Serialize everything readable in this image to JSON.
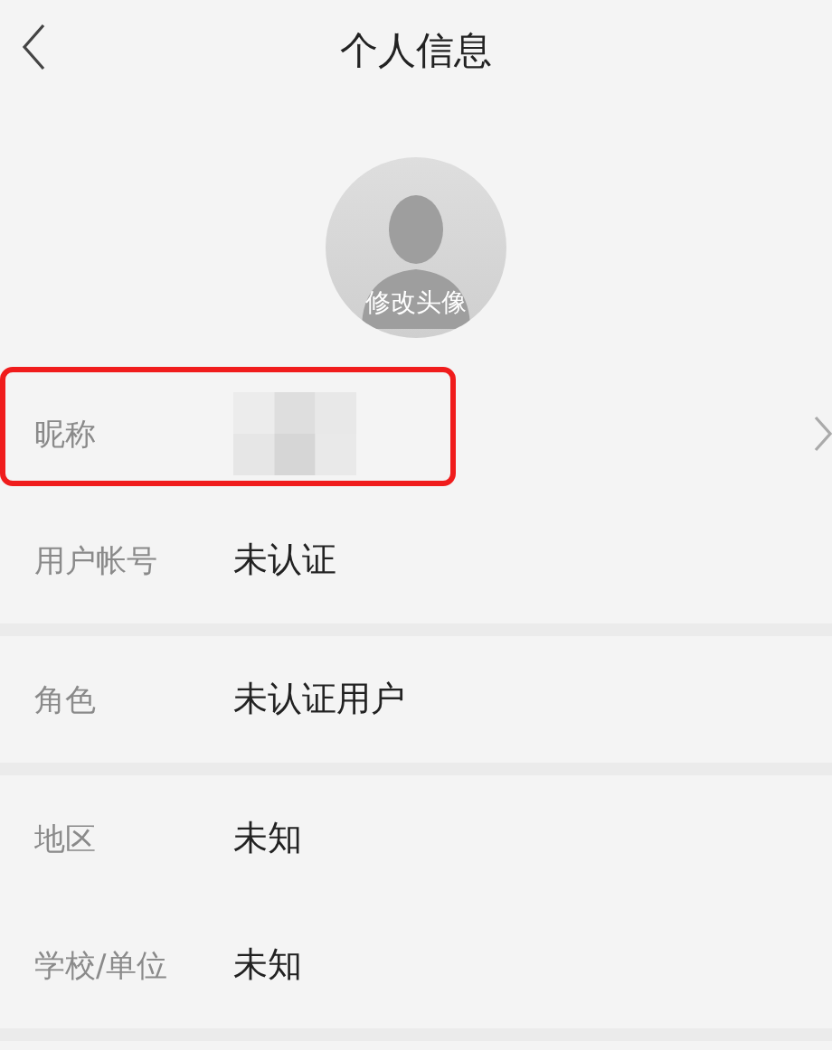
{
  "header": {
    "title": "个人信息"
  },
  "avatar": {
    "caption": "修改头像"
  },
  "sections": [
    {
      "rows": [
        {
          "label": "昵称",
          "kind": "blurred",
          "highlighted": true,
          "chevron": true
        },
        {
          "label": "用户帐号",
          "kind": "text",
          "value": "未认证",
          "highlighted": false,
          "chevron": false
        }
      ]
    },
    {
      "rows": [
        {
          "label": "角色",
          "kind": "text",
          "value": "未认证用户",
          "highlighted": false,
          "chevron": false
        }
      ]
    },
    {
      "rows": [
        {
          "label": "地区",
          "kind": "text",
          "value": "未知",
          "highlighted": false,
          "chevron": false
        },
        {
          "label": "学校/单位",
          "kind": "text",
          "value": "未知",
          "highlighted": false,
          "chevron": false
        }
      ]
    }
  ]
}
